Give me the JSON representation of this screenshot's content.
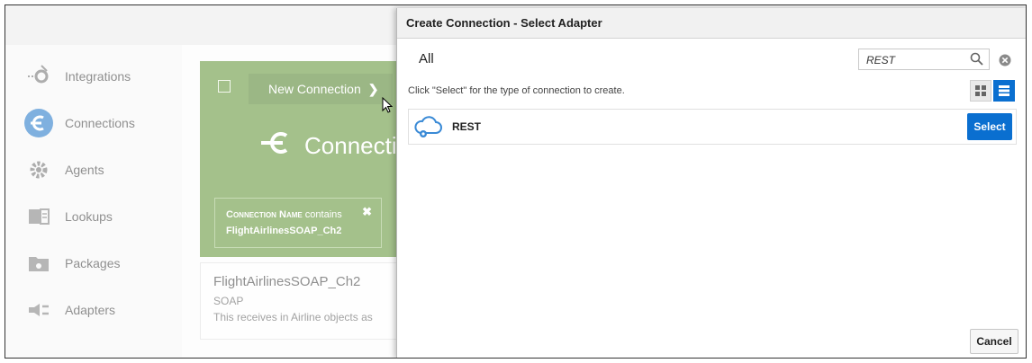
{
  "sidebar": {
    "items": [
      {
        "label": "Integrations",
        "icon": "integrations-icon"
      },
      {
        "label": "Connections",
        "icon": "connections-icon",
        "active": true
      },
      {
        "label": "Agents",
        "icon": "agents-icon"
      },
      {
        "label": "Lookups",
        "icon": "lookups-icon"
      },
      {
        "label": "Packages",
        "icon": "packages-icon"
      },
      {
        "label": "Adapters",
        "icon": "adapters-icon"
      }
    ]
  },
  "panel": {
    "new_connection_label": "New Connection",
    "title": "Connectio",
    "filter": {
      "field": "Connection Name",
      "operator": "contains",
      "value": "FlightAirlinesSOAP_Ch2"
    },
    "result": {
      "name": "FlightAirlinesSOAP_Ch2",
      "type": "SOAP",
      "description": "This receives in Airline objects as"
    }
  },
  "dialog": {
    "title": "Create Connection - Select Adapter",
    "category": "All",
    "search_value": "REST",
    "hint": "Click \"Select\" for the type of connection to create.",
    "adapters": [
      {
        "name": "REST",
        "select_label": "Select"
      }
    ],
    "cancel_label": "Cancel"
  },
  "colors": {
    "green_panel": "#5a8f2d",
    "accent_blue": "#0a6fd0",
    "active_nav": "#1670c5"
  }
}
